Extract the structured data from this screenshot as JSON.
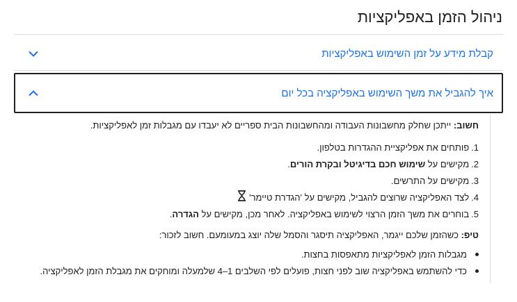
{
  "page": {
    "title": "ניהול הזמן באפליקציות"
  },
  "accordion": [
    {
      "title": "קבלת מידע על זמן השימוש באפליקציות",
      "expanded": false
    },
    {
      "title": "איך להגביל את משך השימוש באפליקציה בכל יום",
      "expanded": true
    }
  ],
  "content": {
    "note_label": "חשוב:",
    "note_text": " ייתכן שחלק מחשבונות העבודה ומהחשבונות הבית ספריים לא יעבדו עם מגבלות זמן לאפליקציות.",
    "steps": [
      {
        "num": "1.",
        "text": "פותחים את אפליקציית ההגדרות בטלפון."
      },
      {
        "num": "2.",
        "pre": "מקישים על ",
        "bold": "שימוש חכם בדיגיטל ובקרת הורים",
        "post": "."
      },
      {
        "num": "3.",
        "text": "מקישים על התרשים."
      },
      {
        "num": "4.",
        "text": "לצד האפליקציה שרוצים להגביל, מקישים על 'הגדרת טיימר'"
      },
      {
        "num": "5.",
        "pre": "בוחרים את משך הזמן הרצוי לשימוש באפליקציה. לאחר מכן, מקישים על ",
        "bold": "הגדרה",
        "post": "."
      }
    ],
    "tip_label": "טיפ:",
    "tip_text": " כשהזמן שלכם ייגמר, האפליקציה תיסגר והסמל שלה יוצג במעומעם. חשוב לזכור:",
    "bullets": [
      "מגבלות הזמן לאפליקציות מתאפסות בחצות.",
      "כדי להשתמש באפליקציה שוב לפני חצות, פועלים לפי השלבים 1–4 שלמעלה ומוחקים את מגבלת הזמן לאפליקציה."
    ]
  },
  "colors": {
    "link": "#1a73e8",
    "text": "#202124",
    "divider": "#dadce0"
  },
  "icons": {
    "collapsed": "chevron-down-icon",
    "expanded": "chevron-up-icon",
    "timer": "hourglass-icon"
  }
}
